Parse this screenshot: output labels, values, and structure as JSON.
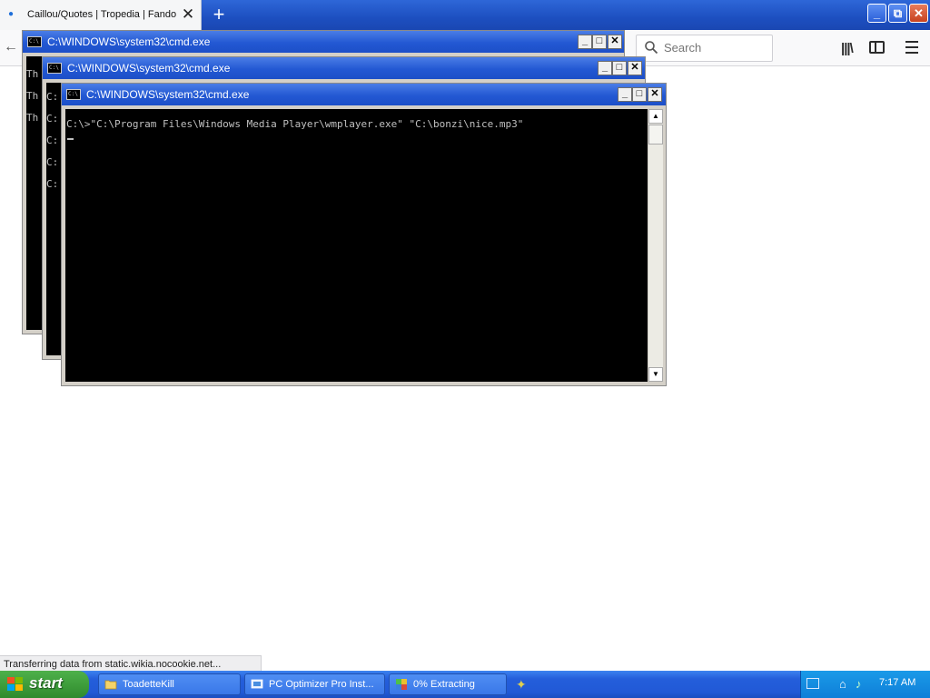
{
  "browser": {
    "tab": {
      "title": "Caillou/Quotes | Tropedia | Fandom",
      "close_glyph": "✕"
    },
    "new_tab_glyph": "+",
    "window_controls": {
      "minimize": "_",
      "restore": "⧉",
      "close": "✕"
    },
    "nav": {
      "back_glyph": "←"
    },
    "search": {
      "placeholder": "Search"
    },
    "status": "Transferring data from static.wikia.nocookie.net..."
  },
  "cmd_windows": [
    {
      "title": "C:\\WINDOWS\\system32\\cmd.exe",
      "lines": [
        "Th",
        "Th",
        "Th"
      ]
    },
    {
      "title": "C:\\WINDOWS\\system32\\cmd.exe",
      "lines": [
        "C:",
        "C:",
        "C:",
        "C:",
        "C:"
      ]
    },
    {
      "title": "C:\\WINDOWS\\system32\\cmd.exe",
      "lines": [
        "C:\\>\"C:\\Program Files\\Windows Media Player\\wmplayer.exe\" \"C:\\bonzi\\nice.mp3\""
      ]
    }
  ],
  "cmd_buttons": {
    "minimize": "_",
    "maximize": "□",
    "close": "✕"
  },
  "sysicon_text": "C:\\",
  "taskbar": {
    "start_label": "start",
    "buttons": [
      {
        "label": "ToadetteKill",
        "icon": "folder-icon"
      },
      {
        "label": "PC Optimizer Pro Inst...",
        "icon": "installer-icon"
      },
      {
        "label": "0% Extracting",
        "icon": "extract-icon"
      }
    ],
    "clock": "7:17 AM"
  },
  "colors": {
    "xp_blue": "#245edb",
    "start_green": "#3c9a39",
    "console_bg": "#000000",
    "console_fg": "#c0c0c0"
  }
}
